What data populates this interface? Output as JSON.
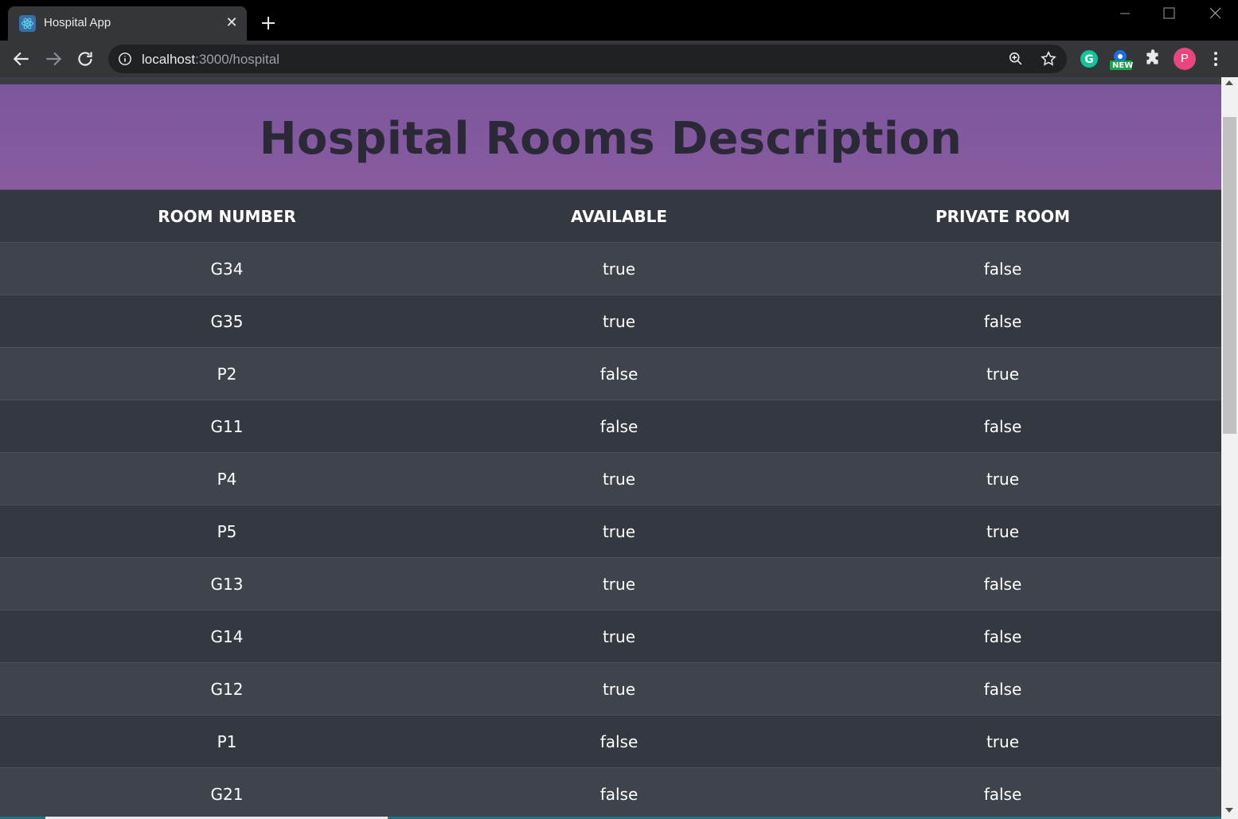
{
  "browser": {
    "tab_title": "Hospital App",
    "tab_close": "✕",
    "url_host": "localhost",
    "url_path": ":3000/hospital",
    "extension_new_badge": "NEW",
    "avatar_letter": "P"
  },
  "page": {
    "title": "Hospital Rooms Description",
    "columns": [
      "ROOM NUMBER",
      "AVAILABLE",
      "PRIVATE ROOM"
    ],
    "rows": [
      {
        "room": "G34",
        "available": "true",
        "private": "false"
      },
      {
        "room": "G35",
        "available": "true",
        "private": "false"
      },
      {
        "room": "P2",
        "available": "false",
        "private": "true"
      },
      {
        "room": "G11",
        "available": "false",
        "private": "false"
      },
      {
        "room": "P4",
        "available": "true",
        "private": "true"
      },
      {
        "room": "P5",
        "available": "true",
        "private": "true"
      },
      {
        "room": "G13",
        "available": "true",
        "private": "false"
      },
      {
        "room": "G14",
        "available": "true",
        "private": "false"
      },
      {
        "room": "G12",
        "available": "true",
        "private": "false"
      },
      {
        "room": "P1",
        "available": "false",
        "private": "true"
      },
      {
        "room": "G21",
        "available": "false",
        "private": "false"
      }
    ]
  },
  "colors": {
    "header_purple": "#7c569c",
    "title_text": "#2b2838",
    "row_odd": "#3f434b",
    "row_even": "#343840"
  }
}
